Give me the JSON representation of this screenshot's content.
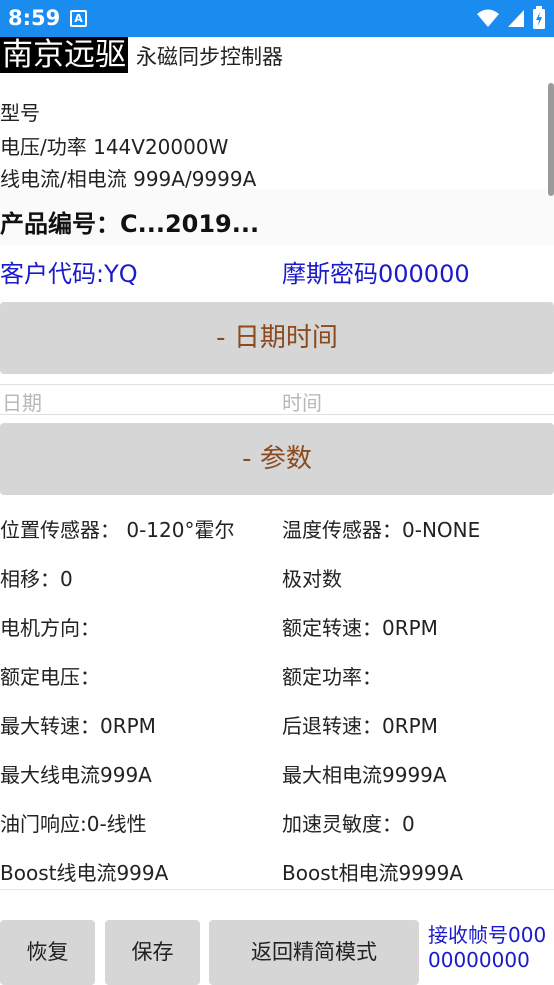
{
  "status_bar": {
    "time": "8:59",
    "notification": "A"
  },
  "header": {
    "brand": "南京远驱",
    "subtitle": "永磁同步控制器"
  },
  "info": {
    "model": "型号",
    "voltage_power": "电压/功率   144V20000W",
    "line_phase_current": "线电流/相电流   999A/9999A"
  },
  "product": {
    "code": "产品编号：C...2019..."
  },
  "customer": {
    "customer_code": "客户代码:YQ",
    "morse_code": "摩斯密码000000"
  },
  "datetime_section": {
    "label": "- 日期时间",
    "date_placeholder": "日期",
    "time_placeholder": "时间"
  },
  "params_section": {
    "label": "- 参数",
    "rows": [
      {
        "left": "位置传感器： 0-120°霍尔",
        "right": "温度传感器：0-NONE"
      },
      {
        "left": "相移：0",
        "right": "极对数"
      },
      {
        "left": "电机方向：",
        "right": "额定转速：0RPM"
      },
      {
        "left": "额定电压：",
        "right": "额定功率："
      },
      {
        "left": "最大转速：0RPM",
        "right": "后退转速：0RPM"
      },
      {
        "left": "最大线电流999A",
        "right": "最大相电流9999A"
      },
      {
        "left": "油门响应:0-线性",
        "right": "加速灵敏度：0"
      },
      {
        "left": "Boost线电流999A",
        "right": "Boost相电流9999A"
      }
    ]
  },
  "bottom_bar": {
    "restore": "恢复",
    "save": "保存",
    "simple_mode": "返回精简模式",
    "frame_number": "接收帧号00000000000"
  },
  "colors": {
    "status_bar": "#1a8cf0",
    "accent_text": "#1a1acc",
    "section_text": "#8b4b1e",
    "button_bg": "#d6d6d6"
  }
}
